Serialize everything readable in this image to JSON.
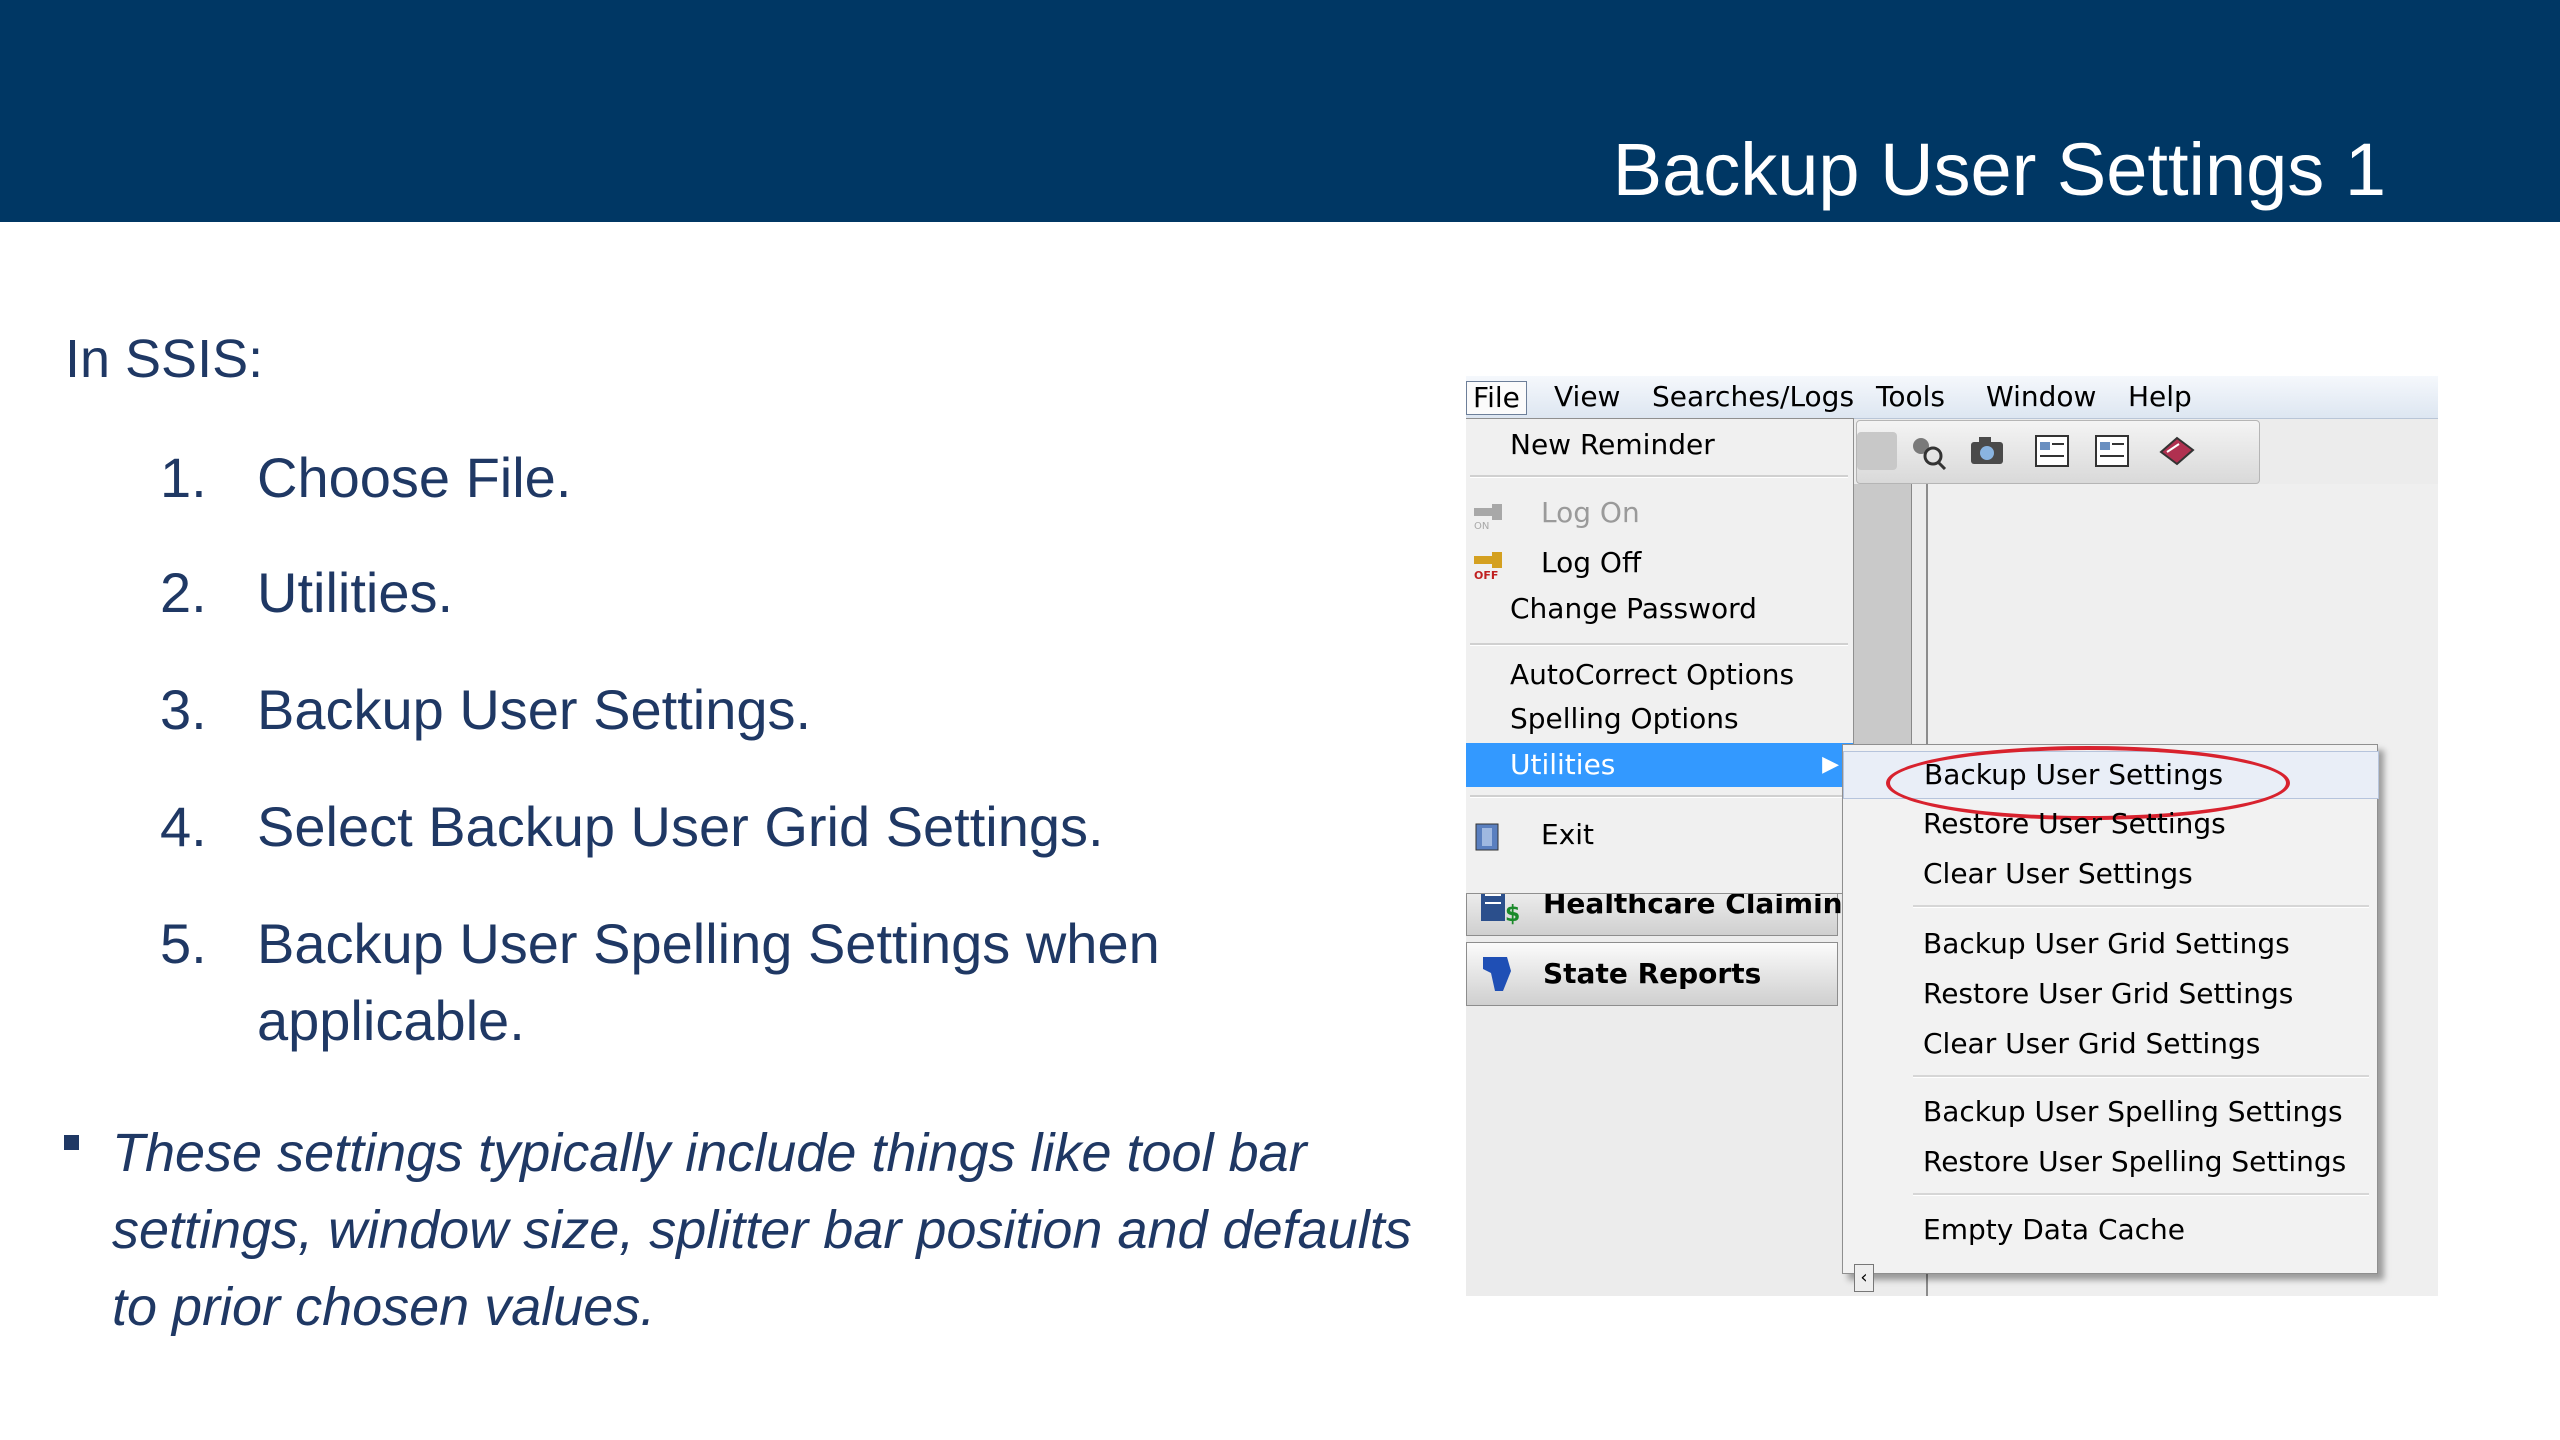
{
  "slide": {
    "title": "Backup User Settings 1",
    "intro": "In SSIS:",
    "steps": [
      {
        "num": "1.",
        "text": "Choose File."
      },
      {
        "num": "2.",
        "text": "Utilities."
      },
      {
        "num": "3.",
        "text": "Backup User Settings."
      },
      {
        "num": "4.",
        "text": "Select Backup User Grid Settings."
      },
      {
        "num": "5.",
        "text": "Backup User Spelling Settings when",
        "text2": "applicable."
      }
    ],
    "bullet": "These settings typically include things like tool bar settings, window size, splitter bar position and defaults to prior chosen values."
  },
  "colors": {
    "header_bg": "#003764",
    "body_text": "#1f3864",
    "menu_highlight": "#3399ff",
    "ring": "#d8222e"
  },
  "app": {
    "menubar": [
      "File",
      "View",
      "Searches/Logs",
      "Tools",
      "Window",
      "Help"
    ],
    "file_menu": {
      "new_reminder": "New Reminder",
      "log_on": "Log On",
      "log_off": "Log Off",
      "change_password": "Change Password",
      "autocorrect": "AutoCorrect Options",
      "spelling": "Spelling Options",
      "utilities": "Utilities",
      "exit": "Exit"
    },
    "nav": {
      "healthcare": "Healthcare Claiming",
      "state_reports": "State Reports"
    },
    "utilities_menu": [
      "Backup User Settings",
      "Restore User Settings",
      "Clear User Settings",
      "Backup User Grid Settings",
      "Restore User Grid Settings",
      "Clear User Grid Settings",
      "Backup User Spelling Settings",
      "Restore User Spelling Settings",
      "Empty Data Cache"
    ],
    "icons": {
      "log_on": "key-on-icon",
      "log_off": "key-off-icon",
      "exit": "exit-door-icon",
      "healthcare": "healthcare-claim-icon",
      "state_reports": "state-map-icon"
    }
  }
}
